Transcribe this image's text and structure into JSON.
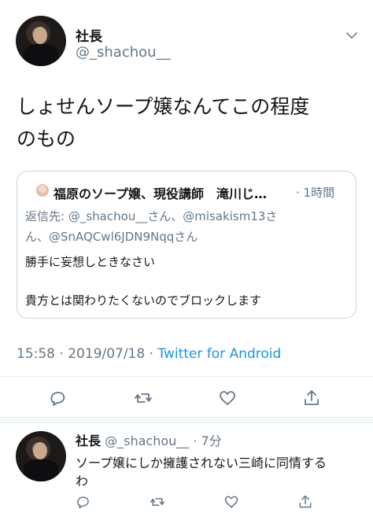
{
  "main_tweet": {
    "display_name": "社長",
    "handle": "@_shachou__",
    "text_line1": "しょせんソープ嬢なんてこの程度",
    "text_line2": "のもの",
    "timestamp": "15:58 · 2019/07/18 · ",
    "source": "Twitter for Android"
  },
  "quoted_tweet": {
    "author": "福原のソープ嬢、現役講師　滝川じ…",
    "time": "· 1時間",
    "reply_line1": "返信先: @_shachou__さん、@misakism13さ",
    "reply_line2": "ん、@SnAQCwl6JDN9Nqqさん",
    "body_line1": "勝手に妄想しときなさい",
    "body_line2": "貴方とは関わりたくないのでブロックします"
  },
  "reply": {
    "display_name": "社長",
    "handle_time": "@_shachou__ · 7分",
    "text_line1": "ソープ嬢にしか擁護されない三崎に同情する",
    "text_line2": "わ"
  },
  "icons": [
    "chevron-down-icon",
    "reply-icon",
    "retweet-icon",
    "like-icon",
    "share-icon"
  ],
  "colors": {
    "link": "#1b95e0",
    "secondary": "#657786",
    "border": "#e6ecf0"
  }
}
